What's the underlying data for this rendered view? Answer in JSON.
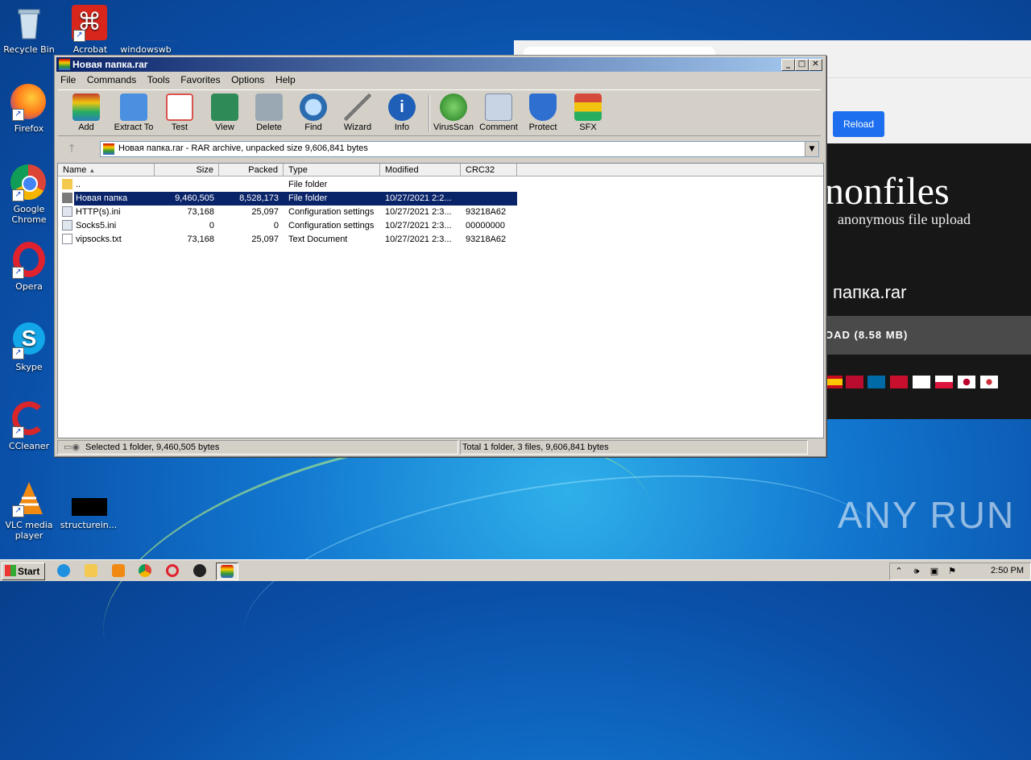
{
  "desktop": {
    "icons": [
      {
        "label": "Recycle Bin",
        "icon": "recycle-bin-icon"
      },
      {
        "label": "Acrobat",
        "icon": "acrobat-icon"
      },
      {
        "label": "windowswb",
        "icon": "shortcut-icon"
      },
      {
        "label": "Firefox",
        "icon": "firefox-icon"
      },
      {
        "label": "Google Chrome",
        "icon": "chrome-icon"
      },
      {
        "label": "Opera",
        "icon": "opera-icon"
      },
      {
        "label": "Skype",
        "icon": "skype-icon"
      },
      {
        "label": "CCleaner",
        "icon": "ccleaner-icon"
      },
      {
        "label": "VLC media player",
        "icon": "vlc-icon"
      },
      {
        "label": "structurein...",
        "icon": "file-icon"
      }
    ]
  },
  "browser": {
    "reload_label": "Reload",
    "brand": "nonfiles",
    "tagline": "anonymous file upload",
    "file_name": "папка.rar",
    "download_label": "OAD (8.58 MB)"
  },
  "winrar": {
    "title": "Новая папка.rar",
    "menu": [
      "File",
      "Commands",
      "Tools",
      "Favorites",
      "Options",
      "Help"
    ],
    "toolbar": [
      {
        "label": "Add",
        "icon": "add-archive-icon",
        "color": "#c0392b"
      },
      {
        "label": "Extract To",
        "icon": "extract-folder-icon",
        "color": "#3b7dd8"
      },
      {
        "label": "Test",
        "icon": "test-checklist-icon",
        "color": "#d9534f"
      },
      {
        "label": "View",
        "icon": "view-book-icon",
        "color": "#2e8b57"
      },
      {
        "label": "Delete",
        "icon": "delete-bin-icon",
        "color": "#8c9aa5"
      },
      {
        "label": "Find",
        "icon": "find-magnifier-icon",
        "color": "#2b6cb0"
      },
      {
        "label": "Wizard",
        "icon": "wizard-wand-icon",
        "color": "#e8c33a"
      },
      {
        "label": "Info",
        "icon": "info-icon",
        "color": "#1f5fb8"
      },
      {
        "label": "VirusScan",
        "icon": "virusscan-bug-icon",
        "color": "#2e9a2e"
      },
      {
        "label": "Comment",
        "icon": "comment-icon",
        "color": "#7a8da6"
      },
      {
        "label": "Protect",
        "icon": "protect-shield-icon",
        "color": "#2f6fd0"
      },
      {
        "label": "SFX",
        "icon": "sfx-box-icon",
        "color": "#d64a3a"
      }
    ],
    "path": "Новая папка.rar - RAR archive, unpacked size 9,606,841 bytes",
    "columns": [
      "Name",
      "Size",
      "Packed",
      "Type",
      "Modified",
      "CRC32"
    ],
    "rows": [
      {
        "name": "..",
        "size": "",
        "packed": "",
        "type": "File folder",
        "modified": "",
        "crc": "",
        "icon": "folder-icon",
        "selected": false
      },
      {
        "name": "Новая папка",
        "size": "9,460,505",
        "packed": "8,528,173",
        "type": "File folder",
        "modified": "10/27/2021 2:2...",
        "crc": "",
        "icon": "folder-icon",
        "selected": true
      },
      {
        "name": "HTTP(s).ini",
        "size": "73,168",
        "packed": "25,097",
        "type": "Configuration settings",
        "modified": "10/27/2021 2:3...",
        "crc": "93218A62",
        "icon": "ini-file-icon",
        "selected": false
      },
      {
        "name": "Socks5.ini",
        "size": "0",
        "packed": "0",
        "type": "Configuration settings",
        "modified": "10/27/2021 2:3...",
        "crc": "00000000",
        "icon": "ini-file-icon",
        "selected": false
      },
      {
        "name": "vipsocks.txt",
        "size": "73,168",
        "packed": "25,097",
        "type": "Text Document",
        "modified": "10/27/2021 2:3...",
        "crc": "93218A62",
        "icon": "text-file-icon",
        "selected": false
      }
    ],
    "status_left": "Selected 1 folder, 9,460,505 bytes",
    "status_right": "Total 1 folder, 3 files, 9,606,841 bytes"
  },
  "taskbar": {
    "start_label": "Start",
    "clock": "2:50 PM",
    "apps": [
      "ie-icon",
      "explorer-icon",
      "media-player-icon",
      "chrome-icon",
      "opera-icon",
      "app-icon",
      "winrar-icon"
    ]
  },
  "watermark": "ANY RUN"
}
